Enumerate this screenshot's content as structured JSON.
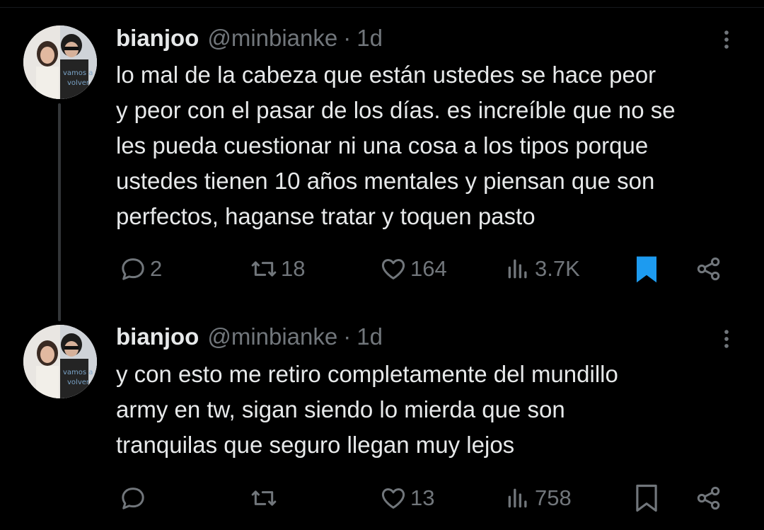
{
  "tweets": [
    {
      "user": {
        "display_name": "bianjoo",
        "handle": "@minbianke",
        "time": "1d"
      },
      "avatar_text": [
        "vamos a",
        "volver"
      ],
      "text_lines": [
        "lo mal de la cabeza que están ustedes se hace peor",
        "y peor con el pasar de los días. es increíble que no se",
        "les pueda cuestionar ni una cosa a los tipos porque",
        "ustedes tienen 10 años mentales y piensan que son",
        "perfectos, haganse tratar y toquen pasto"
      ],
      "actions": {
        "replies": "2",
        "retweets": "18",
        "likes": "164",
        "views": "3.7K",
        "bookmarked": true
      },
      "icons": [
        "reply-icon",
        "retweet-icon",
        "like-icon",
        "views-icon",
        "bookmark-icon",
        "share-icon",
        "more-icon"
      ]
    },
    {
      "user": {
        "display_name": "bianjoo",
        "handle": "@minbianke",
        "time": "1d"
      },
      "avatar_text": [
        "vamos a",
        "volver"
      ],
      "text_lines": [
        "y con esto me retiro completamente del mundillo",
        "army en tw, sigan siendo lo mierda que son",
        "tranquilas que seguro llegan muy lejos"
      ],
      "actions": {
        "replies": "",
        "retweets": "",
        "likes": "13",
        "views": "758",
        "bookmarked": false
      },
      "icons": [
        "reply-icon",
        "retweet-icon",
        "like-icon",
        "views-icon",
        "bookmark-icon",
        "share-icon",
        "more-icon"
      ]
    }
  ],
  "colors": {
    "background": "#000000",
    "text": "#e7e9ea",
    "muted": "#71767b",
    "bookmark_active": "#1d9bf0"
  }
}
